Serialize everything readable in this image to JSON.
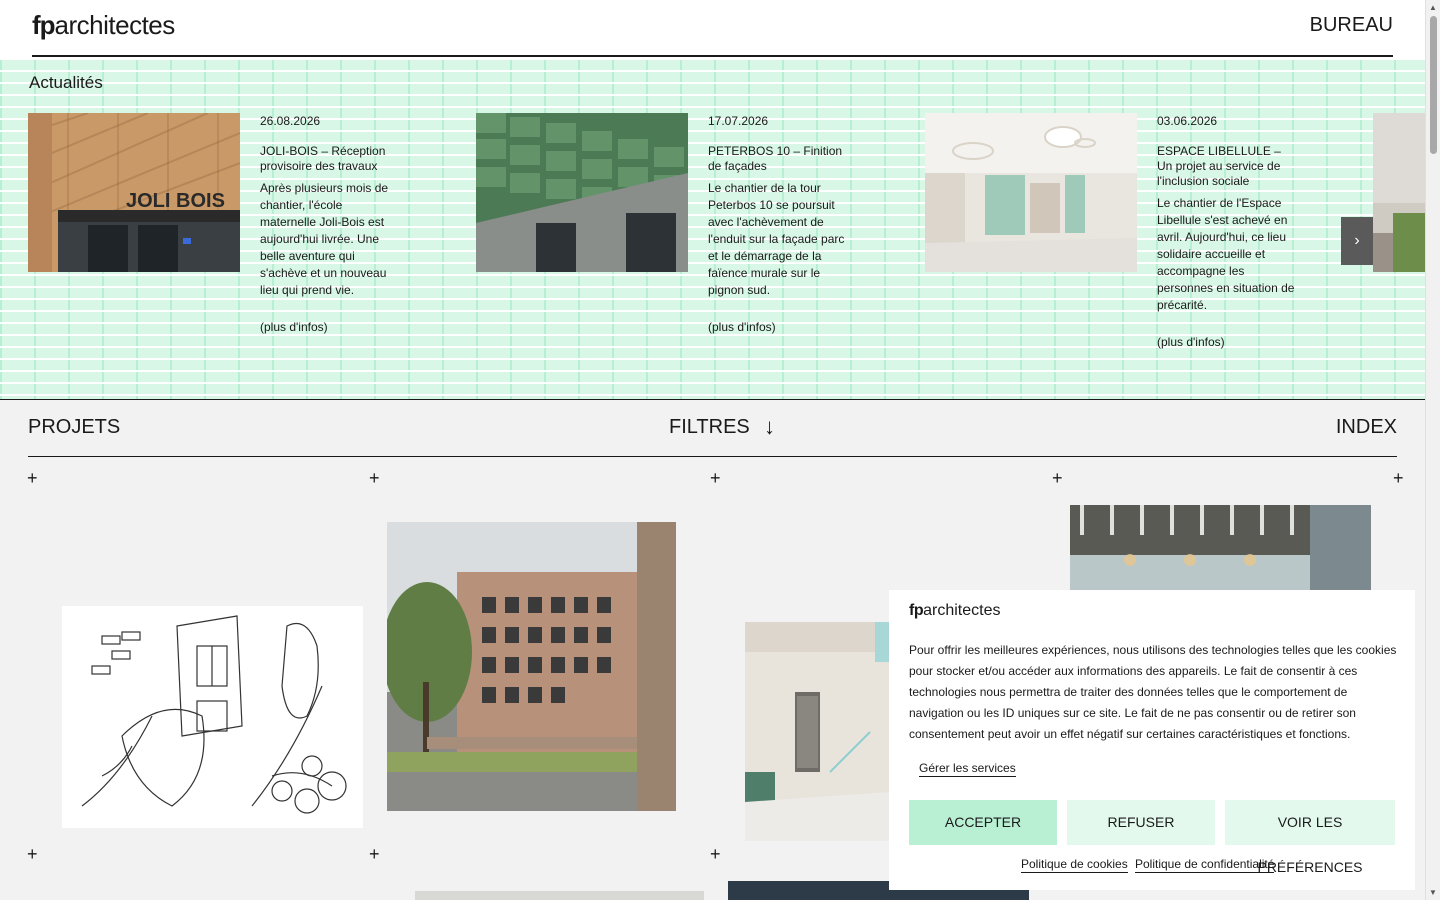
{
  "header": {
    "logo_fp": "fp",
    "logo_text": "architectes",
    "nav_bureau": "BUREAU"
  },
  "news": {
    "title": "Actualités",
    "next_icon": "›",
    "items": [
      {
        "date": "26.08.2026",
        "headline": "JOLI-BOIS – Réception provisoire des travaux",
        "body": "Après plusieurs mois de chantier, l'école maternelle Joli-Bois est aujourd'hui livrée. Une belle aventure qui s'achève et un nouveau lieu qui prend vie.",
        "more": "(plus d'infos)",
        "image_sign_text": "JOLI BOIS"
      },
      {
        "date": "17.07.2026",
        "headline": "PETERBOS 10 – Finition de façades",
        "body": "Le chantier de la tour Peterbos 10 se poursuit avec l'achèvement de l'enduit sur la façade parc et le démarrage de la faïence murale sur le pignon sud.",
        "more": "(plus d'infos)"
      },
      {
        "date": "03.06.2026",
        "headline": "ESPACE LIBELLULE – Un projet au service de l'inclusion sociale",
        "body": "Le chantier de l'Espace Libellule s'est achevé en avril. Aujourd'hui, ce lieu solidaire accueille et accompagne les personnes en situation de précarité.",
        "more": "(plus d'infos)"
      }
    ]
  },
  "projects": {
    "projets_label": "PROJETS",
    "filtres_label": "FILTRES",
    "filtres_arrow": "↓",
    "index_label": "INDEX",
    "plus_icon": "+"
  },
  "cookie": {
    "logo_fp": "fp",
    "logo_text": "architectes",
    "text": "Pour offrir les meilleures expériences, nous utilisons des technologies telles que les cookies pour stocker et/ou accéder aux informations des appareils. Le fait de consentir à ces technologies nous permettra de traiter des données telles que le comportement de navigation ou les ID uniques sur ce site. Le fait de ne pas consentir ou de retirer son consentement peut avoir un effet négatif sur certaines caractéristiques et fonctions.",
    "manage": "Gérer les services",
    "accept": "ACCEPTER",
    "refuse": "REFUSER",
    "prefs": "VOIR LES PRÉFÉRENCES",
    "cookie_policy": "Politique de cookies",
    "privacy_policy": "Politique de confidentialité"
  },
  "colors": {
    "mint_accent": "#b9f0d4",
    "mint_light": "#e4f9ee",
    "news_bg": "#d8f7e6"
  }
}
